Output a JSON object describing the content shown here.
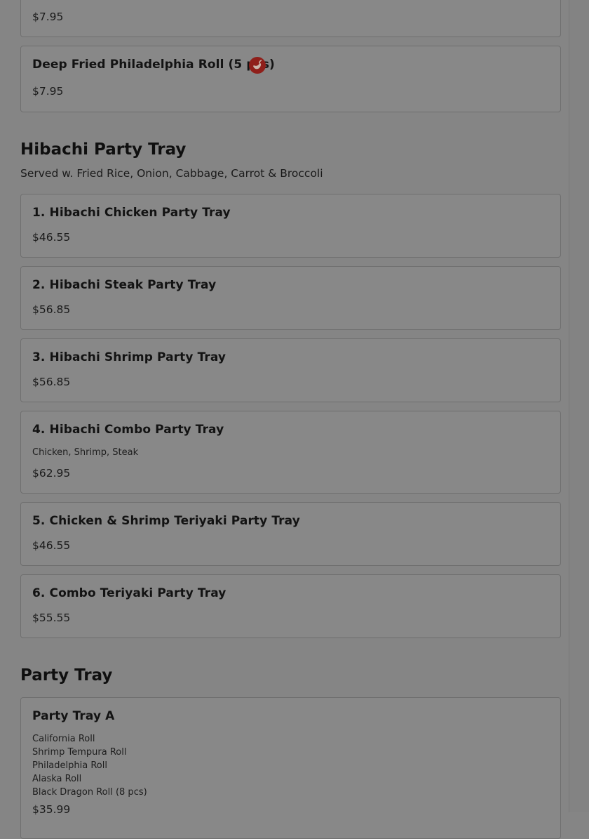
{
  "items_top": [
    {
      "price": "$7.95"
    },
    {
      "name": "Deep Fried Philadelphia Roll (5 pcs)",
      "price": "$7.95",
      "icon": "spicy-pepper-icon"
    }
  ],
  "hibachi": {
    "title": "Hibachi Party Tray",
    "subtitle": "Served w. Fried Rice, Onion, Cabbage, Carrot & Broccoli",
    "items": [
      {
        "name": "1. Hibachi Chicken Party Tray",
        "price": "$46.55"
      },
      {
        "name": "2. Hibachi Steak Party Tray",
        "price": "$56.85"
      },
      {
        "name": "3. Hibachi Shrimp Party Tray",
        "price": "$56.85"
      },
      {
        "name": "4. Hibachi Combo Party Tray",
        "description": "Chicken, Shrimp, Steak",
        "price": "$62.95"
      },
      {
        "name": "5. Chicken & Shrimp Teriyaki Party Tray",
        "price": "$46.55"
      },
      {
        "name": "6. Combo Teriyaki Party Tray",
        "price": "$55.55"
      }
    ]
  },
  "party_tray": {
    "title": "Party Tray",
    "items": [
      {
        "name": "Party Tray A",
        "description_lines": [
          "California Roll",
          "Shrimp Tempura Roll",
          "Philadelphia Roll",
          "Alaska Roll",
          "Black Dragon Roll (8 pcs)"
        ],
        "price": "$35.99"
      }
    ]
  },
  "colors": {
    "overlay_bg": "#858585",
    "card_bg": "#888888",
    "spicy_icon": "#8f1f1a"
  }
}
